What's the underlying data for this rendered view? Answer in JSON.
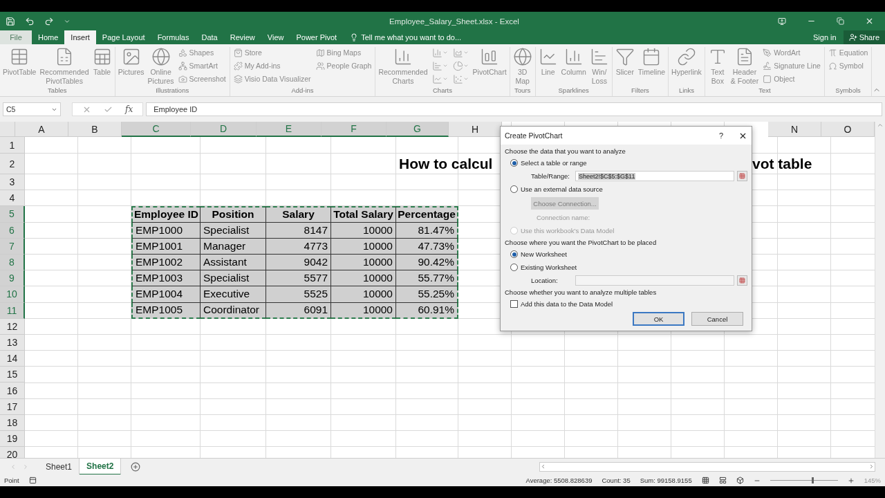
{
  "window": {
    "title": "Employee_Salary_Sheet.xlsx - Excel"
  },
  "tabs": [
    {
      "label": "File",
      "selected": false
    },
    {
      "label": "Home",
      "selected": false
    },
    {
      "label": "Insert",
      "selected": true
    },
    {
      "label": "Page Layout",
      "selected": false
    },
    {
      "label": "Formulas",
      "selected": false
    },
    {
      "label": "Data",
      "selected": false
    },
    {
      "label": "Review",
      "selected": false
    },
    {
      "label": "View",
      "selected": false
    },
    {
      "label": "Power Pivot",
      "selected": false
    }
  ],
  "tell_me": {
    "placeholder": "Tell me what you want to do..."
  },
  "account": {
    "sign_in": "Sign in",
    "share": "Share"
  },
  "ribbon": {
    "groups": [
      {
        "label": "Tables",
        "items": [
          {
            "kind": "large",
            "label": "PivotTable"
          },
          {
            "kind": "large",
            "label": "Recommended\nPivotTables"
          },
          {
            "kind": "large",
            "label": "Table"
          }
        ]
      },
      {
        "label": "Illustrations",
        "items": [
          {
            "kind": "large",
            "label": "Pictures"
          },
          {
            "kind": "large",
            "label": "Online\nPictures"
          },
          {
            "kind": "small",
            "label": "Shapes"
          },
          {
            "kind": "small",
            "label": "SmartArt"
          },
          {
            "kind": "small",
            "label": "Screenshot"
          }
        ]
      },
      {
        "label": "Add-ins",
        "items": [
          {
            "kind": "small",
            "label": "Store"
          },
          {
            "kind": "small",
            "label": "My Add-ins"
          },
          {
            "kind": "small",
            "label": "Visio Data Visualizer"
          },
          {
            "kind": "small",
            "label": "Bing Maps"
          },
          {
            "kind": "small",
            "label": "People Graph"
          }
        ]
      },
      {
        "label": "Charts",
        "items": [
          {
            "kind": "large",
            "label": "Recommended\nCharts"
          },
          {
            "kind": "icon"
          },
          {
            "kind": "icon"
          },
          {
            "kind": "icon"
          },
          {
            "kind": "icon"
          },
          {
            "kind": "icon"
          },
          {
            "kind": "icon"
          },
          {
            "kind": "large",
            "label": "PivotChart"
          }
        ]
      },
      {
        "label": "Tours",
        "items": [
          {
            "kind": "large",
            "label": "3D\nMap"
          }
        ]
      },
      {
        "label": "Sparklines",
        "items": [
          {
            "kind": "large",
            "label": "Line"
          },
          {
            "kind": "large",
            "label": "Column"
          },
          {
            "kind": "large",
            "label": "Win/\nLoss"
          }
        ]
      },
      {
        "label": "Filters",
        "items": [
          {
            "kind": "large",
            "label": "Slicer"
          },
          {
            "kind": "large",
            "label": "Timeline"
          }
        ]
      },
      {
        "label": "Links",
        "items": [
          {
            "kind": "large",
            "label": "Hyperlink"
          }
        ]
      },
      {
        "label": "Text",
        "items": [
          {
            "kind": "large",
            "label": "Text\nBox"
          },
          {
            "kind": "large",
            "label": "Header\n& Footer"
          },
          {
            "kind": "small",
            "label": "WordArt"
          },
          {
            "kind": "small",
            "label": "Signature Line"
          },
          {
            "kind": "small",
            "label": "Object"
          }
        ]
      },
      {
        "label": "Symbols",
        "items": [
          {
            "kind": "small",
            "label": "Equation"
          },
          {
            "kind": "small",
            "label": "Symbol"
          }
        ]
      }
    ]
  },
  "formula_bar": {
    "name_box": "C5",
    "fx": "fx",
    "formula": "Employee ID"
  },
  "sheet": {
    "columns": [
      {
        "label": "A",
        "selected": false
      },
      {
        "label": "B",
        "selected": false
      },
      {
        "label": "C",
        "selected": true
      },
      {
        "label": "D",
        "selected": true
      },
      {
        "label": "E",
        "selected": true
      },
      {
        "label": "F",
        "selected": true
      },
      {
        "label": "G",
        "selected": true
      },
      {
        "label": "H",
        "selected": false
      },
      {
        "label": "N",
        "selected": false
      },
      {
        "label": "O",
        "selected": false
      }
    ],
    "rows": [
      {
        "label": "1",
        "selected": false
      },
      {
        "label": "2",
        "selected": false
      },
      {
        "label": "3",
        "selected": false
      },
      {
        "label": "4",
        "selected": false
      },
      {
        "label": "5",
        "selected": true
      },
      {
        "label": "6",
        "selected": true
      },
      {
        "label": "7",
        "selected": true
      },
      {
        "label": "8",
        "selected": true
      },
      {
        "label": "9",
        "selected": true
      },
      {
        "label": "10",
        "selected": true
      },
      {
        "label": "11",
        "selected": true
      },
      {
        "label": "12",
        "selected": false
      },
      {
        "label": "13",
        "selected": false
      },
      {
        "label": "14",
        "selected": false
      },
      {
        "label": "15",
        "selected": false
      },
      {
        "label": "16",
        "selected": false
      },
      {
        "label": "17",
        "selected": false
      },
      {
        "label": "18",
        "selected": false
      },
      {
        "label": "19",
        "selected": false
      },
      {
        "label": "20",
        "selected": false
      }
    ],
    "title": {
      "left": "How to calcul",
      "right": "vot table"
    },
    "table": {
      "columns": [
        {
          "header": "Employee ID",
          "kind": "text"
        },
        {
          "header": "Position",
          "kind": "text"
        },
        {
          "header": "Salary",
          "kind": "number"
        },
        {
          "header": "Total Salary",
          "kind": "number"
        },
        {
          "header": "Percentage",
          "kind": "number"
        }
      ],
      "rows": [
        [
          "EMP1000",
          "Specialist",
          "8147",
          "10000",
          "81.47%"
        ],
        [
          "EMP1001",
          "Manager",
          "4773",
          "10000",
          "47.73%"
        ],
        [
          "EMP1002",
          "Assistant",
          "9042",
          "10000",
          "90.42%"
        ],
        [
          "EMP1003",
          "Specialist",
          "5577",
          "10000",
          "55.77%"
        ],
        [
          "EMP1004",
          "Executive",
          "5525",
          "10000",
          "55.25%"
        ],
        [
          "EMP1005",
          "Coordinator",
          "6091",
          "10000",
          "60.91%"
        ]
      ]
    }
  },
  "sheet_tabs": [
    {
      "label": "Sheet1",
      "selected": false
    },
    {
      "label": "Sheet2",
      "selected": true
    }
  ],
  "status_bar": {
    "mode": "Point",
    "average": "Average: 5508.828639",
    "count": "Count: 35",
    "sum": "Sum: 99158.9155",
    "zoom": "145%",
    "zoom_slider": {
      "level": 0.62
    }
  },
  "dialog": {
    "title": "Create PivotChart",
    "help": "?",
    "section_1": "Choose the data that you want to analyze",
    "source_options": [
      {
        "label": "Select a table or range",
        "selected": true,
        "disabled": false
      },
      {
        "label": "Use an external data source",
        "selected": false,
        "disabled": false
      }
    ],
    "range_label": "Table/Range:",
    "range_value": "Sheet2!$C$5:$G$11",
    "connection_button": "Choose Connection...",
    "connection_label": "Connection name:",
    "data_model_option": {
      "label": "Use this workbook's Data Model",
      "selected": false,
      "disabled": true
    },
    "section_2": "Choose where you want the PivotChart to be placed",
    "place_options": [
      {
        "label": "New Worksheet",
        "selected": true
      },
      {
        "label": "Existing Worksheet",
        "selected": false
      }
    ],
    "location_label": "Location:",
    "section_3": "Choose whether you want to analyze multiple tables",
    "add_to_model": {
      "label": "Add this data to the Data Model",
      "checked": false
    },
    "ok": "OK",
    "cancel": "Cancel"
  }
}
